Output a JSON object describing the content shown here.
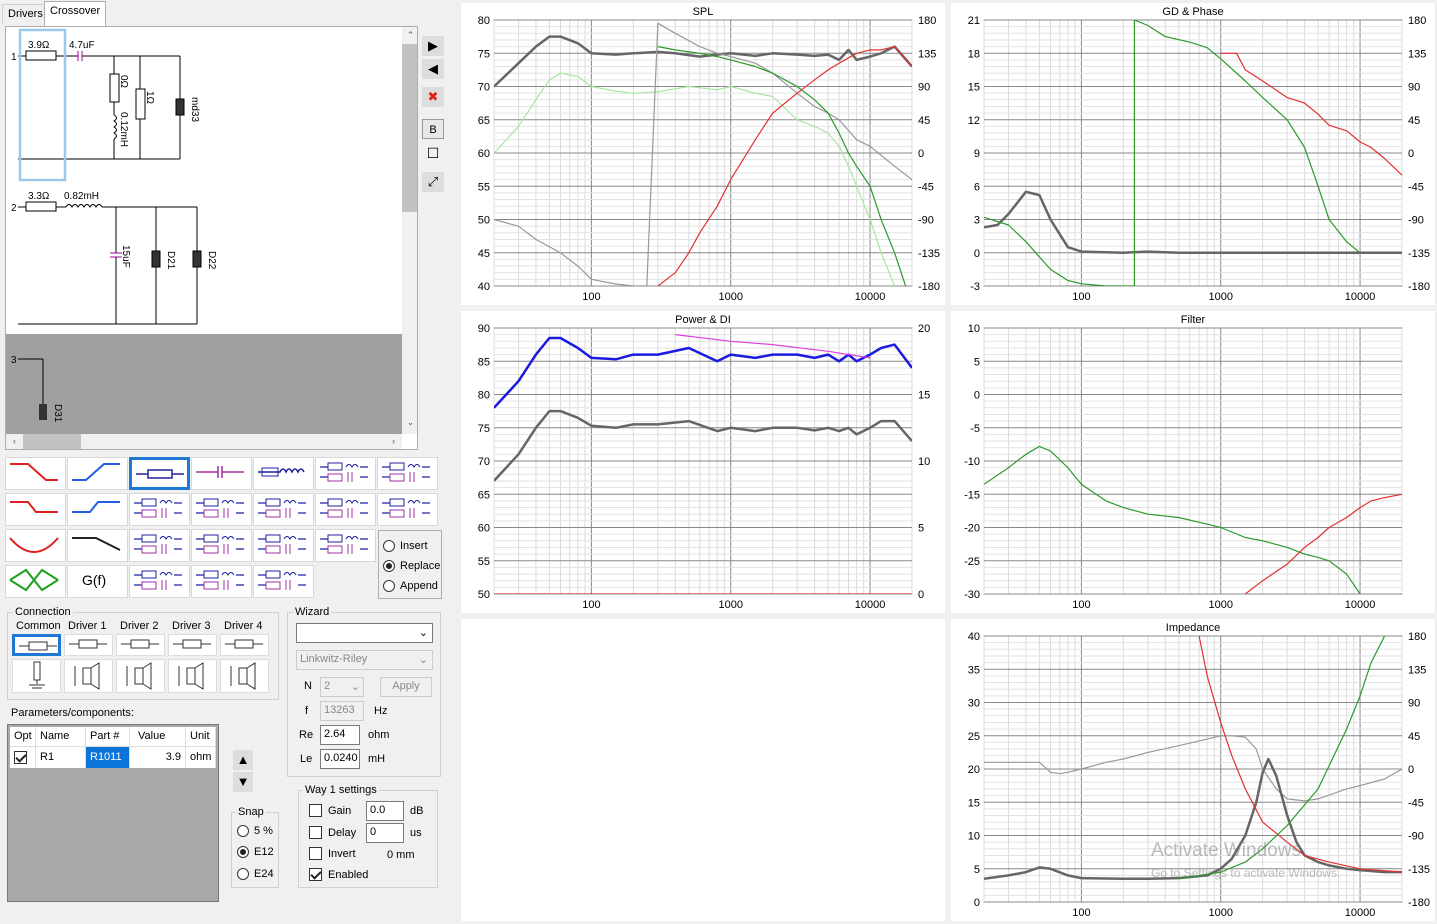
{
  "tabs": [
    "Drivers",
    "Crossover"
  ],
  "schematic": {
    "way1": {
      "index": "1",
      "r1": "3.9Ω",
      "c1": "4.7uF",
      "r2": "0Ω",
      "l1": "0.12mH",
      "r3": "1Ω",
      "driver": "md33"
    },
    "way2": {
      "index": "2",
      "r1": "3.3Ω",
      "l1": "0.82mH",
      "c1": "15uF",
      "d1": "D21",
      "d2": "D22"
    },
    "way3": {
      "index": "3",
      "d1": "D31"
    }
  },
  "component_icons": [
    "high-cut",
    "low-cut",
    "resistor",
    "capacitor",
    "inductor",
    "rc-series",
    "lc-series",
    "notch-hi",
    "notch-lo",
    "rl-parallel",
    "rc-parallel",
    "rl-series",
    "rlc-series",
    "lrc-series",
    "bandstop",
    "shelf",
    "rlc-parallel-a",
    "rlc-parallel-b",
    "rlc-parallel-c",
    "rlc-parallel-d",
    "bandpass",
    "g-of-f",
    "rlc-ladder-a",
    "rlc-ladder-b",
    "rlc-ladder-c"
  ],
  "gf_label": "G(f)",
  "insert_mode": {
    "options": [
      "Insert",
      "Replace",
      "Append"
    ],
    "selected": "Replace"
  },
  "connection": {
    "label": "Connection",
    "columns": [
      "Common",
      "Driver 1",
      "Driver 2",
      "Driver 3",
      "Driver 4"
    ]
  },
  "wizard": {
    "label": "Wizard",
    "type_value": "",
    "alignment": "Linkwitz-Riley",
    "n_label": "N",
    "n_value": "2",
    "apply_label": "Apply",
    "f_label": "f",
    "f_value": "13263",
    "f_unit": "Hz",
    "re_label": "Re",
    "re_value": "2.64",
    "re_unit": "ohm",
    "le_label": "Le",
    "le_value": "0.0240",
    "le_unit": "mH"
  },
  "parameters": {
    "label": "Parameters/components:",
    "headers": [
      "Opt",
      "Name",
      "Part #",
      "Value",
      "Unit"
    ],
    "rows": [
      {
        "opt": true,
        "name": "R1",
        "part": "R1011",
        "value": "3.9",
        "unit": "ohm"
      }
    ]
  },
  "snap": {
    "label": "Snap",
    "options": [
      "5 %",
      "E12",
      "E24"
    ],
    "selected": "E12"
  },
  "way_settings": {
    "label": "Way 1 settings",
    "gain_label": "Gain",
    "gain_value": "0.0",
    "gain_unit": "dB",
    "delay_label": "Delay",
    "delay_value": "0",
    "delay_unit": "us",
    "invert_label": "Invert",
    "invert_value": "0 mm",
    "enabled_label": "Enabled"
  },
  "watermark": {
    "line1": "Activate Windows",
    "line2": "Go to Settings to activate Windows."
  },
  "chart_data": [
    {
      "id": "spl",
      "type": "line",
      "title": "SPL",
      "x_ticks": [
        "100",
        "1000",
        "10000"
      ],
      "xlim": [
        20,
        20000
      ],
      "xscale": "log",
      "y_ticks": [
        80,
        75,
        70,
        65,
        60,
        55,
        50,
        45,
        40
      ],
      "ylim": [
        40,
        80
      ],
      "y2_ticks": [
        180,
        135,
        90,
        45,
        0,
        -45,
        -90,
        -135,
        -180
      ],
      "y2lim": [
        -180,
        180
      ],
      "series": [
        {
          "color": "#666666",
          "width": 2.5,
          "x": [
            20,
            30,
            40,
            50,
            60,
            80,
            100,
            150,
            200,
            300,
            400,
            600,
            800,
            1000,
            1500,
            2000,
            3000,
            4000,
            5000,
            6000,
            7000,
            8000,
            10000,
            12000,
            15000,
            20000
          ],
          "y": [
            70,
            73.5,
            76,
            77.5,
            77.5,
            76.5,
            75,
            74.8,
            75,
            75.2,
            75,
            74.5,
            74.8,
            75,
            74.6,
            75,
            74.8,
            74.6,
            74.8,
            74,
            75.5,
            74,
            74.5,
            75,
            76,
            73
          ]
        },
        {
          "color": "#a8e6a0",
          "width": 1.2,
          "x": [
            20,
            30,
            40,
            50,
            60,
            80,
            100,
            150,
            200,
            300,
            500,
            800,
            1000,
            1500,
            2000,
            3000,
            4000,
            5000,
            6000,
            7000,
            8000,
            10000,
            12000,
            15000
          ],
          "y": [
            60,
            64,
            68,
            71,
            72,
            71.5,
            70,
            69.3,
            69,
            69.2,
            70,
            69.5,
            70,
            69,
            68.5,
            65,
            64,
            63,
            61,
            58,
            55,
            50,
            45,
            40
          ]
        },
        {
          "color": "#999999",
          "width": 1.2,
          "x": [
            20,
            30,
            40,
            60,
            80,
            100,
            150,
            200,
            250,
            300,
            400,
            600,
            800,
            1000,
            1500,
            2000,
            3000,
            4000,
            5000,
            6000,
            8000,
            10000,
            15000,
            20000
          ],
          "y": [
            50,
            49,
            47,
            45,
            43,
            41,
            40.3,
            40,
            40,
            79.5,
            78,
            76,
            75,
            74.5,
            73.5,
            72,
            69,
            67,
            66,
            65,
            62,
            61,
            58,
            56
          ]
        },
        {
          "color": "#2a9a2a",
          "width": 1.2,
          "x": [
            300,
            400,
            600,
            800,
            1000,
            1500,
            2000,
            3000,
            4000,
            5000,
            6000,
            7000,
            8000,
            10000,
            12000,
            15000,
            18000
          ],
          "y": [
            76,
            75.5,
            75,
            74.5,
            74,
            73,
            72,
            70,
            68,
            66,
            63,
            60,
            58,
            55,
            50,
            45,
            40
          ]
        },
        {
          "color": "#e03030",
          "width": 1.2,
          "x": [
            300,
            400,
            500,
            600,
            800,
            1000,
            1500,
            2000,
            3000,
            4000,
            5000,
            6000,
            8000,
            10000,
            12000,
            15000,
            20000
          ],
          "y": [
            40,
            42,
            45,
            48,
            52,
            56,
            62,
            66,
            69,
            71,
            72.5,
            73.5,
            75,
            75.5,
            75.5,
            76,
            73
          ]
        }
      ]
    },
    {
      "id": "gd",
      "type": "line",
      "title": "GD & Phase",
      "x_ticks": [
        "100",
        "1000",
        "10000"
      ],
      "xlim": [
        20,
        20000
      ],
      "xscale": "log",
      "y_ticks": [
        21,
        18,
        15,
        12,
        9,
        6,
        3,
        0,
        -3
      ],
      "ylim": [
        -3,
        21
      ],
      "y2_ticks": [
        180,
        135,
        90,
        45,
        0,
        -45,
        -90,
        -135,
        -180
      ],
      "y2lim": [
        -180,
        180
      ],
      "series": [
        {
          "color": "#666666",
          "width": 2.5,
          "x": [
            20,
            25,
            30,
            40,
            50,
            60,
            80,
            100,
            200,
            300,
            500,
            1000,
            2000,
            5000,
            10000,
            20000
          ],
          "y": [
            2.3,
            2.5,
            3.5,
            5.5,
            5.2,
            3,
            0.5,
            0.1,
            0,
            0.1,
            0,
            0,
            0,
            0,
            0,
            0
          ]
        },
        {
          "color": "#2a9a2a",
          "width": 1.2,
          "x": [
            20,
            30,
            40,
            60,
            80,
            100,
            150,
            200,
            240,
            240,
            300,
            400,
            600,
            800,
            1000,
            1500,
            2000,
            3000,
            4000,
            5000,
            6000,
            8000,
            10000
          ],
          "y": [
            3.2,
            2.5,
            1,
            -1.5,
            -2.5,
            -2.8,
            -3,
            -3,
            -3,
            21,
            20.5,
            19.5,
            19,
            18.5,
            17.5,
            15.5,
            14,
            12,
            9.5,
            6,
            3,
            1,
            0
          ]
        },
        {
          "color": "#e03030",
          "width": 1.2,
          "x": [
            1000,
            1300,
            1500,
            2000,
            3000,
            4000,
            5000,
            6000,
            8000,
            10000,
            12000,
            15000,
            20000
          ],
          "y": [
            18,
            18,
            16.5,
            15.5,
            14,
            13.5,
            12.5,
            11.5,
            11,
            10,
            9.5,
            8.5,
            7
          ]
        }
      ]
    },
    {
      "id": "power",
      "type": "line",
      "title": "Power & DI",
      "x_ticks": [
        "100",
        "1000",
        "10000"
      ],
      "xlim": [
        20,
        20000
      ],
      "xscale": "log",
      "y_ticks": [
        90,
        85,
        80,
        75,
        70,
        65,
        60,
        55,
        50
      ],
      "ylim": [
        50,
        90
      ],
      "y2_ticks": [
        20,
        15,
        10,
        5,
        0
      ],
      "y2lim": [
        0,
        20
      ],
      "series": [
        {
          "color": "#1a1ae0",
          "width": 2.5,
          "x": [
            20,
            30,
            40,
            50,
            60,
            80,
            100,
            150,
            200,
            300,
            500,
            800,
            1000,
            1500,
            2000,
            3000,
            4000,
            5000,
            6000,
            7000,
            8000,
            10000,
            12000,
            15000,
            20000
          ],
          "y": [
            78,
            82,
            86,
            88.5,
            88.5,
            87,
            85.5,
            85.3,
            86,
            86,
            87,
            85,
            86,
            85.5,
            86,
            86,
            85.5,
            86,
            85,
            86,
            85,
            86,
            87,
            87.5,
            84
          ]
        },
        {
          "color": "#666666",
          "width": 2.5,
          "x": [
            20,
            30,
            40,
            50,
            60,
            80,
            100,
            150,
            200,
            300,
            500,
            800,
            1000,
            1500,
            2000,
            3000,
            4000,
            5000,
            6000,
            7000,
            8000,
            10000,
            12000,
            15000,
            20000
          ],
          "y": [
            67,
            71,
            75,
            77.5,
            77.5,
            76.5,
            75.3,
            75,
            75.5,
            75.5,
            76,
            74.5,
            75,
            74.5,
            75,
            75,
            74.6,
            75,
            74.5,
            75,
            74,
            75,
            76,
            76,
            73
          ]
        },
        {
          "color": "#e040e0",
          "width": 1.2,
          "x": [
            400,
            1000,
            2000,
            5000,
            10000
          ],
          "y": [
            89,
            88,
            87.5,
            86.5,
            85.5
          ]
        },
        {
          "color": "#e03030",
          "width": 1.2,
          "x": [
            20,
            20000
          ],
          "y": [
            50,
            50
          ]
        }
      ]
    },
    {
      "id": "filter",
      "type": "line",
      "title": "Filter",
      "x_ticks": [
        "100",
        "1000",
        "10000"
      ],
      "xlim": [
        20,
        20000
      ],
      "xscale": "log",
      "y_ticks": [
        10,
        5,
        0,
        -5,
        -10,
        -15,
        -20,
        -25,
        -30
      ],
      "ylim": [
        -30,
        10
      ],
      "series": [
        {
          "color": "#2a9a2a",
          "width": 1.2,
          "x": [
            20,
            30,
            40,
            50,
            60,
            80,
            100,
            150,
            200,
            300,
            500,
            800,
            1000,
            1500,
            2000,
            3000,
            4000,
            5000,
            6000,
            8000,
            10000
          ],
          "y": [
            -13.5,
            -11,
            -9,
            -7.8,
            -8.5,
            -11,
            -13.5,
            -16,
            -17,
            -18,
            -18.5,
            -19.5,
            -20,
            -21.5,
            -22,
            -23,
            -24,
            -24.5,
            -25,
            -27,
            -30
          ]
        },
        {
          "color": "#e03030",
          "width": 1.2,
          "x": [
            1500,
            2000,
            3000,
            4000,
            5000,
            6000,
            8000,
            10000,
            12000,
            15000,
            20000
          ],
          "y": [
            -30,
            -28,
            -25.5,
            -23,
            -21.5,
            -20,
            -18.5,
            -17,
            -16,
            -15.5,
            -15
          ]
        }
      ]
    },
    {
      "id": "impedance",
      "type": "line",
      "title": "Impedance",
      "x_ticks": [
        "100",
        "1000",
        "10000"
      ],
      "xlim": [
        20,
        20000
      ],
      "xscale": "log",
      "y_ticks": [
        40,
        35,
        30,
        25,
        20,
        15,
        10,
        5,
        0
      ],
      "ylim": [
        0,
        40
      ],
      "y2_ticks": [
        180,
        135,
        90,
        45,
        0,
        -45,
        -90,
        -135,
        -180
      ],
      "y2lim": [
        -180,
        180
      ],
      "series": [
        {
          "color": "#999999",
          "width": 1.2,
          "x": [
            20,
            30,
            40,
            50,
            60,
            70,
            80,
            100,
            150,
            200,
            300,
            500,
            800,
            1000,
            1200,
            1500,
            1800,
            2000,
            2500,
            3000,
            4000,
            5000,
            8000,
            10000,
            15000,
            20000
          ],
          "y": [
            21,
            21,
            21,
            21,
            19.5,
            19.3,
            19.5,
            20,
            21,
            21.5,
            22.5,
            23.5,
            24.5,
            25,
            25,
            24.8,
            23,
            20,
            17,
            15.5,
            15.2,
            15.5,
            17,
            17.5,
            18.5,
            20
          ]
        },
        {
          "color": "#666666",
          "width": 2.5,
          "x": [
            20,
            30,
            40,
            50,
            60,
            80,
            100,
            200,
            300,
            500,
            800,
            1000,
            1200,
            1500,
            1800,
            2000,
            2200,
            2500,
            3000,
            3500,
            4000,
            5000,
            6000,
            8000,
            10000,
            15000,
            20000
          ],
          "y": [
            3.5,
            4,
            4.5,
            5.2,
            5,
            4,
            3.6,
            3.5,
            3.5,
            3.6,
            4,
            5,
            6.5,
            10,
            15,
            19.5,
            21.5,
            19,
            13,
            9,
            7,
            6,
            5.5,
            5,
            4.8,
            4.5,
            4.5
          ]
        },
        {
          "color": "#e03030",
          "width": 1.2,
          "x": [
            700,
            800,
            1000,
            1200,
            1500,
            2000,
            3000,
            4000,
            6000,
            10000,
            20000
          ],
          "y": [
            40,
            34,
            27,
            22,
            17,
            12,
            9,
            7,
            6,
            5,
            4.5
          ]
        },
        {
          "color": "#2a9a2a",
          "width": 1.2,
          "x": [
            500,
            1000,
            1500,
            2000,
            3000,
            5000,
            8000,
            10000,
            12000,
            15000
          ],
          "y": [
            3.5,
            4.5,
            6,
            8,
            11.5,
            17,
            26,
            31,
            36,
            40
          ]
        }
      ]
    }
  ]
}
